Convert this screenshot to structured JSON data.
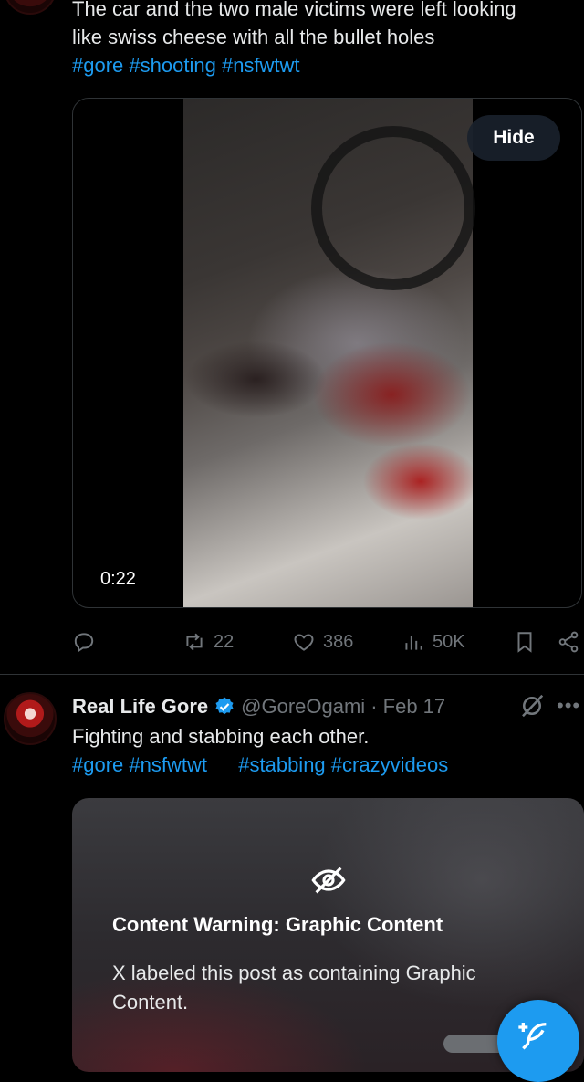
{
  "post1": {
    "text_line1": "The car and the two male victims were left looking",
    "text_line2": "like swiss cheese with all the bullet holes",
    "hashtags": [
      "#gore",
      "#shooting",
      "#nsfwtwt"
    ],
    "video": {
      "hide_label": "Hide",
      "duration": "0:22"
    },
    "actions": {
      "reposts": "22",
      "likes": "386",
      "views": "50K"
    }
  },
  "post2": {
    "author_name": "Real Life Gore",
    "verified": true,
    "handle": "@GoreOgami",
    "date": "· Feb 17",
    "text": "Fighting and stabbing each other.",
    "hashtags": [
      "#gore",
      "#nsfwtwt",
      "#stabbing",
      "#crazyvideos"
    ],
    "warning": {
      "title": "Content Warning: Graphic Content",
      "body_line1": "X labeled this post as containing Graphic",
      "body_line2": "Content."
    }
  },
  "colors": {
    "accent": "#1d9bf0",
    "muted": "#71767b",
    "text": "#e7e9ea",
    "background": "#000000"
  }
}
